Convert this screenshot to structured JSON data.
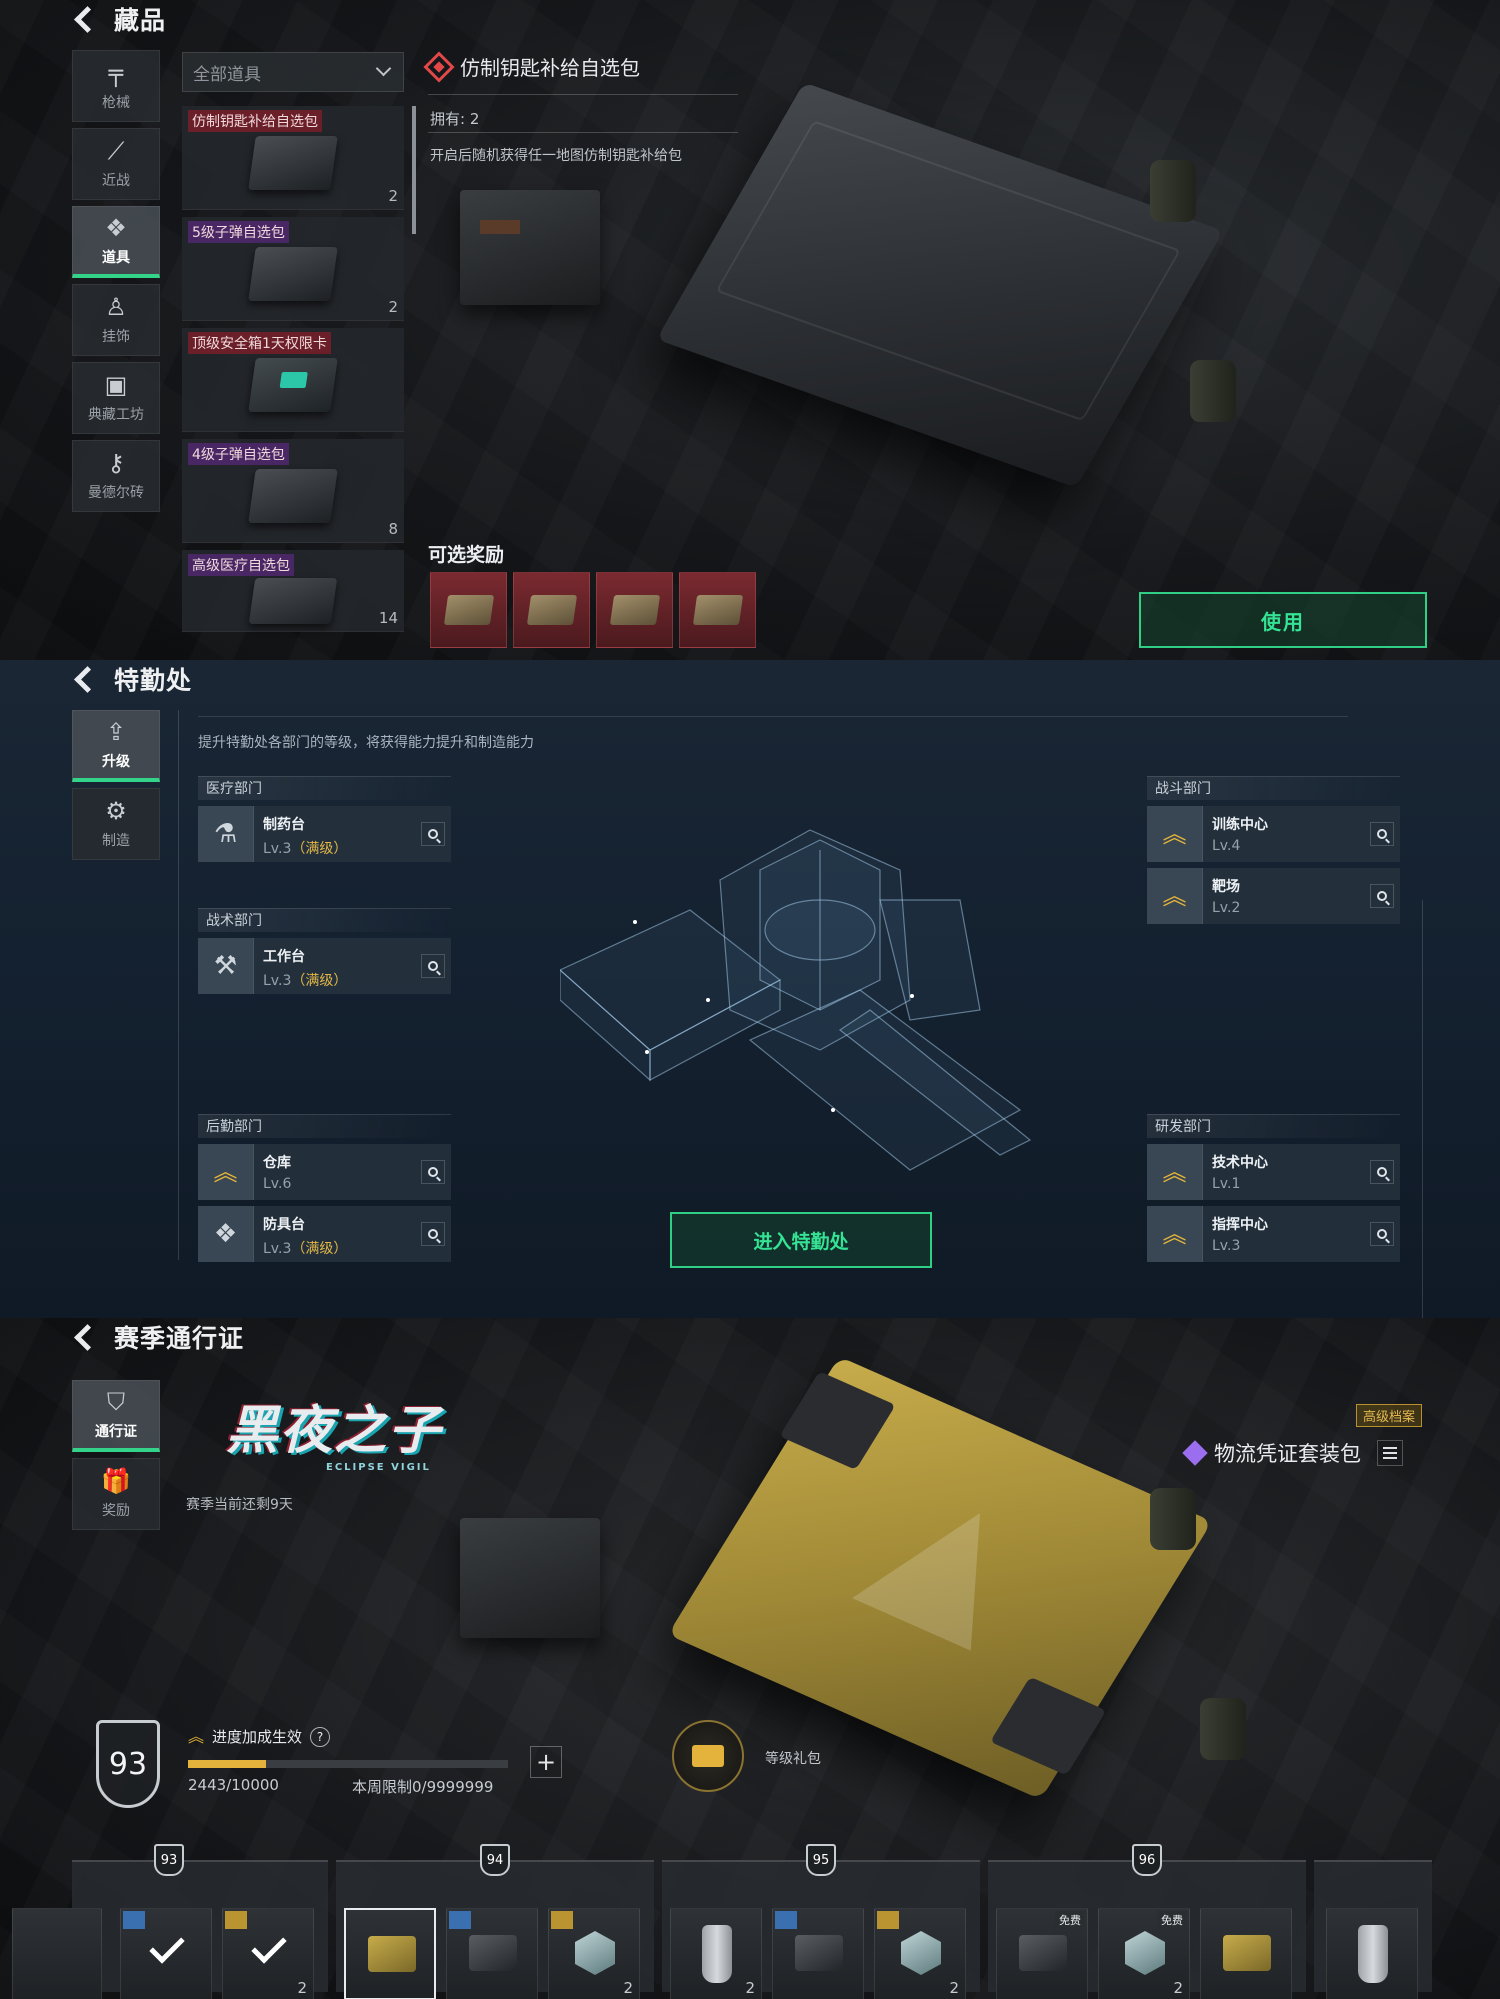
{
  "collection": {
    "title": "藏品",
    "nav": [
      "枪械",
      "近战",
      "道具",
      "挂饰",
      "典藏工坊",
      "曼德尔砖"
    ],
    "active_nav": "道具",
    "filter": "全部道具",
    "items": [
      {
        "name": "仿制钥匙补给自选包",
        "qty": "2",
        "tag": "red"
      },
      {
        "name": "5级子弹自选包",
        "qty": "2",
        "tag": "purple"
      },
      {
        "name": "顶级安全箱1天权限卡",
        "qty": "",
        "tag": "red"
      },
      {
        "name": "4级子弹自选包",
        "qty": "8",
        "tag": "purple"
      },
      {
        "name": "高级医疗自选包",
        "qty": "14",
        "tag": "purple"
      }
    ],
    "detail": {
      "name": "仿制钥匙补给自选包",
      "owned": "拥有: 2",
      "desc": "开启后随机获得任一地图仿制钥匙补给包",
      "rewards_label": "可选奖励",
      "use_button": "使用"
    },
    "colors": {
      "accent": "#33d38a",
      "rare": "#e14848"
    }
  },
  "agency": {
    "title": "特勤处",
    "nav": [
      "升级",
      "制造"
    ],
    "active_nav": "升级",
    "subtitle": "提升特勤处各部门的等级，将获得能力提升和制造能力",
    "enter_button": "进入特勤处",
    "departments": {
      "medical": {
        "name": "医疗部门",
        "facilities": [
          {
            "name": "制药台",
            "lv": "Lv.3",
            "max": "（满级）"
          }
        ]
      },
      "tactics": {
        "name": "战术部门",
        "facilities": [
          {
            "name": "工作台",
            "lv": "Lv.3",
            "max": "（满级）"
          }
        ]
      },
      "logistics": {
        "name": "后勤部门",
        "facilities": [
          {
            "name": "仓库",
            "lv": "Lv.6",
            "max": ""
          },
          {
            "name": "防具台",
            "lv": "Lv.3",
            "max": "（满级）"
          }
        ]
      },
      "combat": {
        "name": "战斗部门",
        "facilities": [
          {
            "name": "训练中心",
            "lv": "Lv.4",
            "max": ""
          },
          {
            "name": "靶场",
            "lv": "Lv.2",
            "max": ""
          }
        ]
      },
      "rnd": {
        "name": "研发部门",
        "facilities": [
          {
            "name": "技术中心",
            "lv": "Lv.1",
            "max": ""
          },
          {
            "name": "指挥中心",
            "lv": "Lv.3",
            "max": ""
          }
        ]
      }
    }
  },
  "pass": {
    "title": "赛季通行证",
    "nav": [
      "通行证",
      "奖励"
    ],
    "active_nav": "通行证",
    "season_title": "黑夜之子",
    "season_subtitle": "ECLIPSE VIGIL",
    "days_left": "赛季当前还剩9天",
    "premium_badge": "高级档案",
    "bundle": "物流凭证套装包",
    "level": "93",
    "boost": "进度加成生效",
    "xp": "2443/10000",
    "xp_progress": 0.2443,
    "weekly_limit": "本周限制0/9999999",
    "gift_label": "等级礼包",
    "track_levels": [
      "93",
      "94",
      "95",
      "96"
    ],
    "free_label": "免费",
    "slot_counts": {
      "a": "2",
      "b": "2",
      "c": "2",
      "d": "2",
      "e": "2"
    }
  }
}
